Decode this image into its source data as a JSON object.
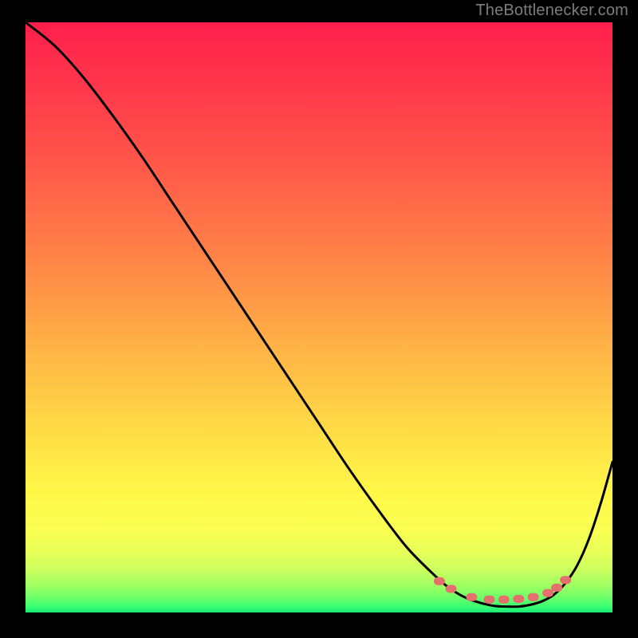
{
  "attribution": "TheBottlenecker.com",
  "chart_data": {
    "type": "line",
    "title": "",
    "xlabel": "",
    "ylabel": "",
    "xlim": [
      0,
      100
    ],
    "ylim": [
      0,
      100
    ],
    "series": [
      {
        "name": "curve",
        "x": [
          0,
          5,
          10,
          15,
          20,
          25,
          30,
          35,
          40,
          45,
          50,
          55,
          60,
          65,
          70,
          72,
          74,
          76,
          78,
          80,
          82,
          84,
          86,
          88,
          90,
          92,
          94,
          96,
          98,
          100
        ],
        "y": [
          100,
          96,
          90.5,
          84,
          77,
          69.5,
          62,
          54.5,
          47,
          39.5,
          32,
          24.5,
          17.5,
          11,
          6,
          4.3,
          3,
          2.1,
          1.5,
          1.1,
          1,
          1,
          1.3,
          1.9,
          3,
          5,
          8,
          12.5,
          18.5,
          25.5
        ]
      }
    ],
    "markers": {
      "name": "dots",
      "x": [
        70.5,
        72.5,
        76,
        79,
        81.5,
        84,
        86.5,
        89,
        90.5,
        92
      ],
      "y": [
        5.3,
        4.0,
        2.6,
        2.2,
        2.2,
        2.3,
        2.6,
        3.3,
        4.2,
        5.5
      ]
    },
    "gradient_stops": [
      {
        "offset": 0.0,
        "color": "#ff1f4b"
      },
      {
        "offset": 0.12,
        "color": "#ff3a4b"
      },
      {
        "offset": 0.25,
        "color": "#ff5a49"
      },
      {
        "offset": 0.4,
        "color": "#ff8447"
      },
      {
        "offset": 0.55,
        "color": "#ffb246"
      },
      {
        "offset": 0.7,
        "color": "#ffde46"
      },
      {
        "offset": 0.8,
        "color": "#fff848"
      },
      {
        "offset": 0.86,
        "color": "#faff52"
      },
      {
        "offset": 0.9,
        "color": "#e6ff59"
      },
      {
        "offset": 0.93,
        "color": "#c7ff5f"
      },
      {
        "offset": 0.955,
        "color": "#9dff62"
      },
      {
        "offset": 0.975,
        "color": "#6cff68"
      },
      {
        "offset": 0.99,
        "color": "#3bff73"
      },
      {
        "offset": 1.0,
        "color": "#18e876"
      }
    ],
    "marker_color": "#e56f6c",
    "curve_color": "#000000"
  }
}
